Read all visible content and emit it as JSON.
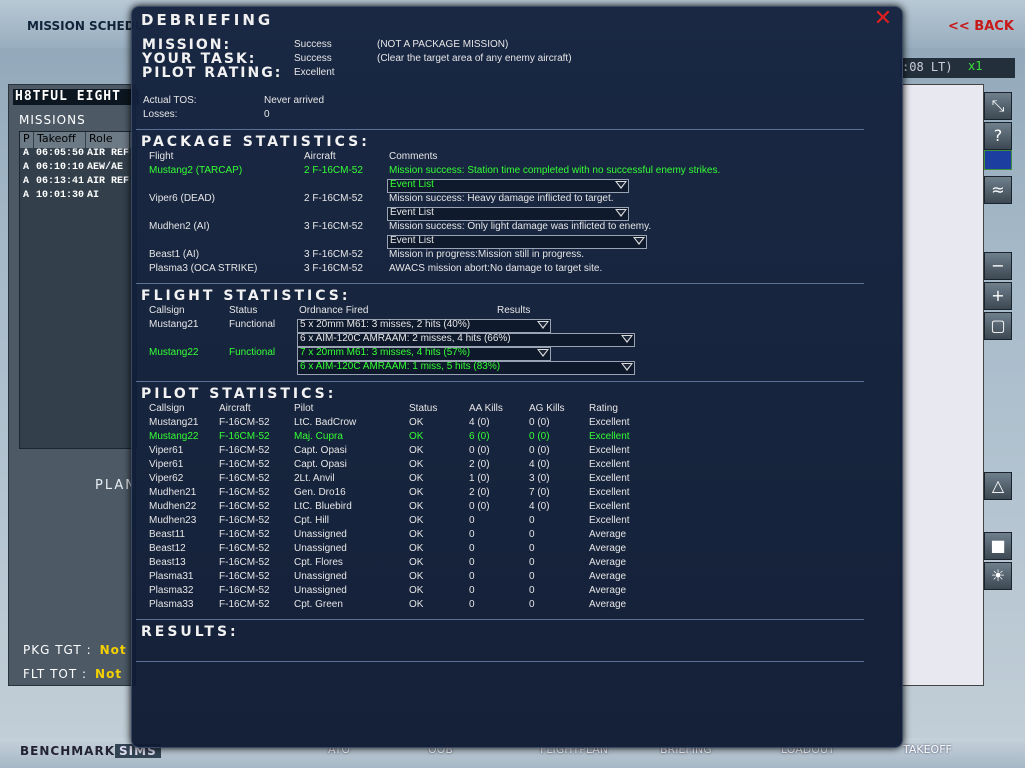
{
  "background": {
    "title": "MISSION SCHEDU",
    "back_label": "<< BACK",
    "squadron_header": "H8TFUL EIGHT",
    "missions_label": "MISSIONS",
    "missions_columns": [
      "P",
      "Takeoff",
      "Role"
    ],
    "missions_rows": [
      {
        "p": "A",
        "takeoff": "06:05:50",
        "role": "AIR REF"
      },
      {
        "p": "A",
        "takeoff": "06:10:10",
        "role": "AEW/AE"
      },
      {
        "p": "A",
        "takeoff": "06:13:41",
        "role": "AIR REF"
      },
      {
        "p": "A",
        "takeoff": "10:01:30",
        "role": "AI"
      }
    ],
    "plan_label": "PLAN",
    "pkg_tgt_label": "PKG TGT :",
    "pkg_tgt_value": "Not",
    "flt_tot_label": "FLT TOT :",
    "flt_tot_value": "Not",
    "map_time": ":08 LT)",
    "map_zoom": "x1",
    "logo_bench": "BENCHMARK",
    "logo_sims": "SIMS",
    "nav_tabs": [
      "ATO",
      "OOB",
      "FLIGHTPLAN",
      "BRIEFING",
      "LOADOUT",
      "TAKEOFF"
    ],
    "tool_icons": [
      "resize-icon",
      "help-icon",
      "flag-icon",
      "wave-icon",
      "zoom-out-icon",
      "zoom-in-icon",
      "fit-icon",
      "terrain-icon",
      "box-icon",
      "weather-icon"
    ]
  },
  "dialog": {
    "title": "DEBRIEFING",
    "mission_label": "MISSION:",
    "mission_value": "Success",
    "mission_note": "(NOT A PACKAGE MISSION)",
    "task_label": "YOUR TASK:",
    "task_value": "Success",
    "task_note": "(Clear the target area of any enemy aircraft)",
    "rating_label": "PILOT RATING:",
    "rating_value": "Excellent",
    "tos_label": "Actual TOS:",
    "tos_value": "Never arrived",
    "losses_label": "Losses:",
    "losses_value": "0",
    "package_title": "PACKAGE STATISTICS:",
    "package_cols": [
      "Flight",
      "Aircraft",
      "Comments"
    ],
    "event_list_label": "Event List",
    "package_rows": [
      {
        "flight": "Mustang2 (TARCAP)",
        "aircraft": "2 F-16CM-52",
        "comment": "Mission success: Station time completed with no successful enemy strikes."
      },
      {
        "flight": "Viper6 (DEAD)",
        "aircraft": "2 F-16CM-52",
        "comment": "Mission success: Heavy damage inflicted to target."
      },
      {
        "flight": "Mudhen2 (AI)",
        "aircraft": "3 F-16CM-52",
        "comment": "Mission success: Only light damage was inflicted to enemy."
      },
      {
        "flight": "Beast1 (AI)",
        "aircraft": "3 F-16CM-52",
        "comment": "Mission in progress:Mission still in progress."
      },
      {
        "flight": "Plasma3 (OCA STRIKE)",
        "aircraft": "3 F-16CM-52",
        "comment": "AWACS mission abort:No damage to target site."
      }
    ],
    "flight_title": "FLIGHT STATISTICS:",
    "flight_cols": [
      "Callsign",
      "Status",
      "Ordnance Fired",
      "Results"
    ],
    "flight_rows": [
      {
        "callsign": "Mustang21",
        "status": "Functional",
        "ord1": "5 x 20mm M61: 3 misses, 2 hits (40%)",
        "ord2": "6 x AIM-120C AMRAAM: 2 misses, 4 hits (66%)"
      },
      {
        "callsign": "Mustang22",
        "status": "Functional",
        "ord1": "7 x 20mm M61: 3 misses, 4 hits (57%)",
        "ord2": "6 x AIM-120C AMRAAM: 1 miss, 5 hits (83%)"
      }
    ],
    "pilot_title": "PILOT STATISTICS:",
    "pilot_cols": [
      "Callsign",
      "Aircraft",
      "Pilot",
      "Status",
      "AA Kills",
      "AG Kills",
      "Rating"
    ],
    "pilot_rows": [
      [
        "Mustang21",
        "F-16CM-52",
        "LtC. BadCrow",
        "OK",
        "4 (0)",
        "0 (0)",
        "Excellent"
      ],
      [
        "Mustang22",
        "F-16CM-52",
        "Maj. Cupra",
        "OK",
        "6 (0)",
        "0 (0)",
        "Excellent"
      ],
      [
        "Viper61",
        "F-16CM-52",
        "Capt. Opasi",
        "OK",
        "0 (0)",
        "0 (0)",
        "Excellent"
      ],
      [
        "Viper61",
        "F-16CM-52",
        "Capt. Opasi",
        "OK",
        "2 (0)",
        "4 (0)",
        "Excellent"
      ],
      [
        "Viper62",
        "F-16CM-52",
        "2Lt. Anvil",
        "OK",
        "1 (0)",
        "3 (0)",
        "Excellent"
      ],
      [
        "Mudhen21",
        "F-16CM-52",
        "Gen. Dro16",
        "OK",
        "2 (0)",
        "7 (0)",
        "Excellent"
      ],
      [
        "Mudhen22",
        "F-16CM-52",
        "LtC. Bluebird",
        "OK",
        "0 (0)",
        "4 (0)",
        "Excellent"
      ],
      [
        "Mudhen23",
        "F-16CM-52",
        "Cpt. Hill",
        "OK",
        "0",
        "0",
        "Excellent"
      ],
      [
        "Beast11",
        "F-16CM-52",
        "Unassigned",
        "OK",
        "0",
        "0",
        "Average"
      ],
      [
        "Beast12",
        "F-16CM-52",
        "Unassigned",
        "OK",
        "0",
        "0",
        "Average"
      ],
      [
        "Beast13",
        "F-16CM-52",
        "Cpt. Flores",
        "OK",
        "0",
        "0",
        "Average"
      ],
      [
        "Plasma31",
        "F-16CM-52",
        "Unassigned",
        "OK",
        "0",
        "0",
        "Average"
      ],
      [
        "Plasma32",
        "F-16CM-52",
        "Unassigned",
        "OK",
        "0",
        "0",
        "Average"
      ],
      [
        "Plasma33",
        "F-16CM-52",
        "Cpt. Green",
        "OK",
        "0",
        "0",
        "Average"
      ]
    ],
    "results_title": "RESULTS:",
    "highlight_color": "#33ff33"
  }
}
